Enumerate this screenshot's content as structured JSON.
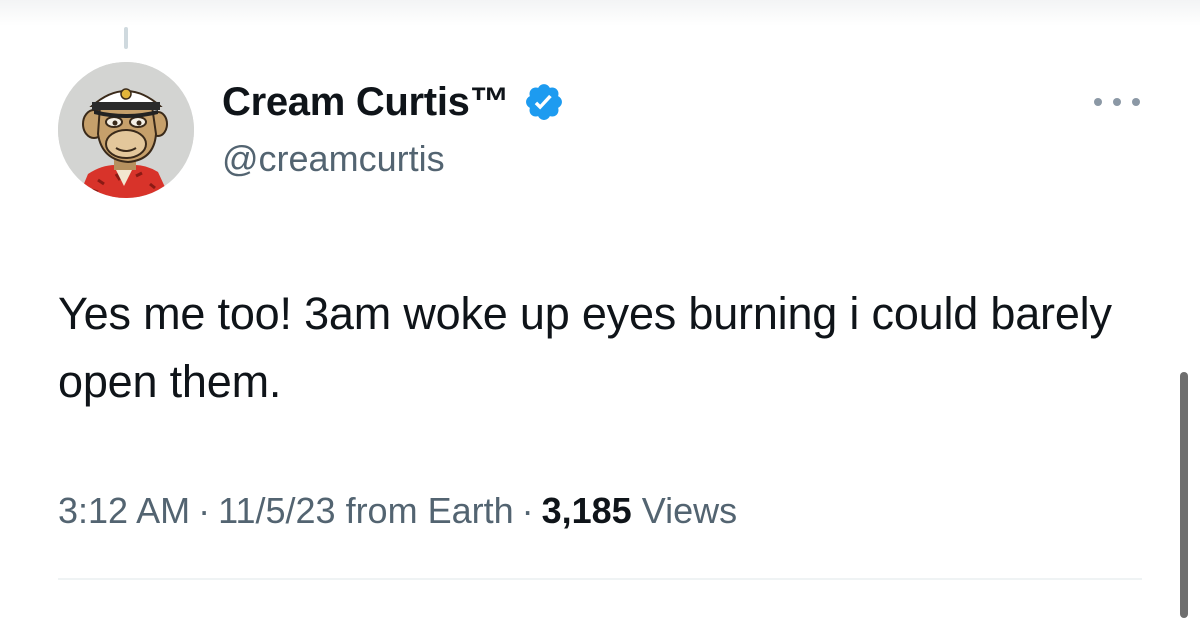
{
  "tweet": {
    "author": {
      "display_name": "Cream Curtis™",
      "handle": "@creamcurtis",
      "verified": true,
      "avatar_icon": "bored-ape-captain-hat-avatar"
    },
    "more_icon": "ellipsis-icon",
    "text": "Yes me too! 3am woke up eyes burning i could barely open them.",
    "meta": {
      "time": "3:12 AM",
      "date": "11/5/23",
      "source": "from Earth",
      "separator": "·",
      "views_count": "3,185",
      "views_label": "Views"
    }
  },
  "colors": {
    "verified_badge": "#1d9bf0",
    "text_primary": "#0f1419",
    "text_secondary": "#536471"
  }
}
